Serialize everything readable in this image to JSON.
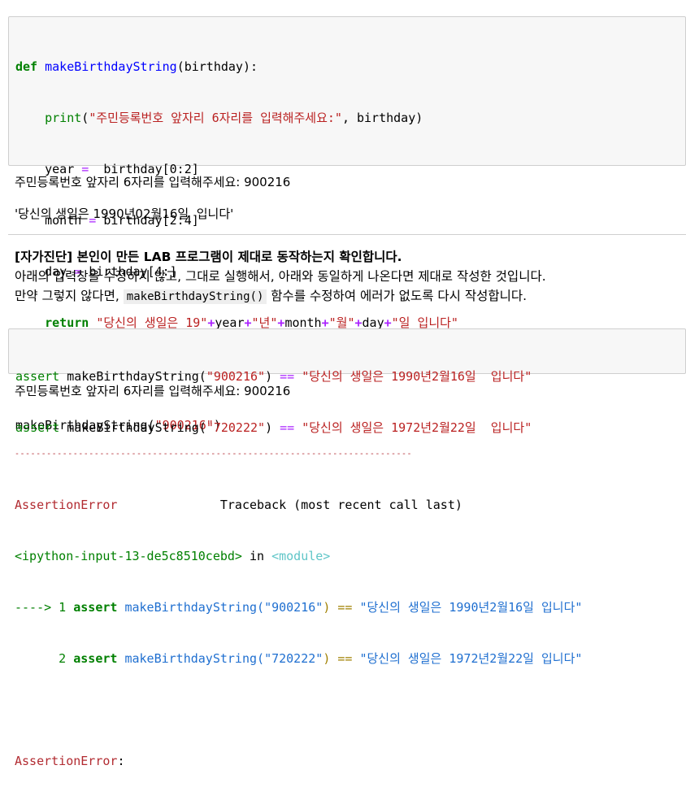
{
  "cell1": {
    "code": {
      "def_kw": "def",
      "func_name": "makeBirthdayString",
      "params": "(birthday):",
      "l2_print": "print",
      "l2_open": "(",
      "l2_str": "\"주민등록번호 앞자리 6자리를 입력해주세요:\"",
      "l2_rest": ", birthday)",
      "l3_var": "year",
      "l3_eq": " = ",
      "l3_rest": " birthday[0:2]",
      "l4_var": "month",
      "l4_eq": " = ",
      "l4_rest": "birthday[2:4]",
      "l5_var": "day",
      "l5_eq": " = ",
      "l5_rest": "birthday[4:]",
      "l6_ret": "return",
      "l6_s1": "\"당신의 생일은 19\"",
      "l6_v1": "year",
      "l6_s2": "\"년\"",
      "l6_v2": "month",
      "l6_s3": "\"월\"",
      "l6_v3": "day",
      "l6_s4": "\"일 입니다\"",
      "l8_call": "makeBirthdayString(",
      "l8_arg": "\"900216\"",
      "l8_close": ")"
    },
    "output_print": "주민등록번호 앞자리 6자리를 입력해주세요: 900216",
    "output_return": "'당신의 생일은 1990년02월16일  입니다'"
  },
  "markdown": {
    "heading": "[자가진단] 본인이 만든 LAB 프로그램이 제대로 동작하는지 확인합니다.",
    "line1": "아래의 입력창을 수정하지 않고, 그대로 실행해서, 아래와 동일하게 나온다면 제대로 작성한 것입니다.",
    "line2_pre": "만약 그렇지 않다면, ",
    "line2_code": "makeBirthdayString()",
    "line2_post": " 함수를 수정하여 에러가 없도록 다시 작성합니다."
  },
  "cell2": {
    "a1_kw": "assert",
    "a1_call": " makeBirthdayString(",
    "a1_arg": "\"900216\"",
    "a1_close": ") ",
    "a1_eq": "==",
    "a1_str": " \"당신의 생일은 1990년2월16일  입니다\"",
    "a2_kw": "assert",
    "a2_call": " makeBirthdayString(",
    "a2_arg": "\"720222\"",
    "a2_close": ") ",
    "a2_eq": "==",
    "a2_str": " \"당신의 생일은 1972년2월22일  입니다\"",
    "output_print": "주민등록번호 앞자리 6자리를 입력해주세요: 900216"
  },
  "traceback": {
    "rule": "---------------------------------------------------------------------------",
    "error_name": "AssertionError",
    "header_right": "Traceback (most recent call last)",
    "input_ref": "<ipython-input-13-de5c8510cebd>",
    "in_word": " in ",
    "module": "<module>",
    "arrow": "----> 1",
    "t1_kw": " assert",
    "t1_call": " makeBirthdayString(",
    "t1_arg": "\"900216\"",
    "t1_close": ")",
    "t1_eq": " == ",
    "t1_str": "\"당신의 생일은 1990년2월16일 입니다\"",
    "l2_num": "      2",
    "t2_kw": " assert",
    "t2_call": " makeBirthdayString(",
    "t2_arg": "\"720222\"",
    "t2_close": ")",
    "t2_eq": " == ",
    "t2_str": "\"당신의 생일은 1972년2월22일 입니다\"",
    "final_error": "AssertionError",
    "final_colon": ":"
  }
}
